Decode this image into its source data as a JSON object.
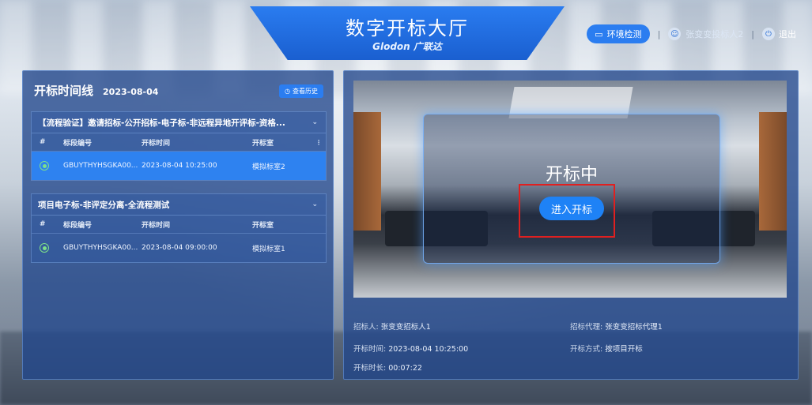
{
  "header": {
    "title": "数字开标大厅",
    "logo": "Glodon 广联达",
    "env_check": "环境检测",
    "user_name": "张变变投标人2",
    "logout": "退出",
    "separator": "|"
  },
  "timeline": {
    "title": "开标时间线",
    "date": "2023-08-04",
    "history_button": "查看历史",
    "columns": [
      "#",
      "标段编号",
      "开标时间",
      "开标室"
    ],
    "groups": [
      {
        "name": "【流程验证】邀请招标-公开招标-电子标-非远程异地开评标-资格...",
        "rows": [
          {
            "code": "GBUYTHYHSGKA00...",
            "time": "2023-08-04 10:25:00",
            "room": "模拟标室2",
            "active": true
          }
        ]
      },
      {
        "name": "项目电子标-非评定分离-全流程测试",
        "rows": [
          {
            "code": "GBUYTHYHSGKA00...",
            "time": "2023-08-04 09:00:00",
            "room": "模拟标室1",
            "active": false
          }
        ]
      }
    ]
  },
  "room": {
    "status": "开标中",
    "enter_button": "进入开标",
    "tenderer_label": "招标人:",
    "tenderer": "张变变招标人1",
    "agent_label": "招标代理:",
    "agent": "张变变招标代理1",
    "open_time_label": "开标时间:",
    "open_time": "2023-08-04 10:25:00",
    "method_label": "开标方式:",
    "method": "按项目开标",
    "duration_label": "开标时长:",
    "duration": "00:07:22"
  },
  "colors": {
    "accent": "#2b7df0",
    "panel": "#21468c",
    "highlight_box": "#e02020",
    "status_dot": "#7de08a"
  }
}
